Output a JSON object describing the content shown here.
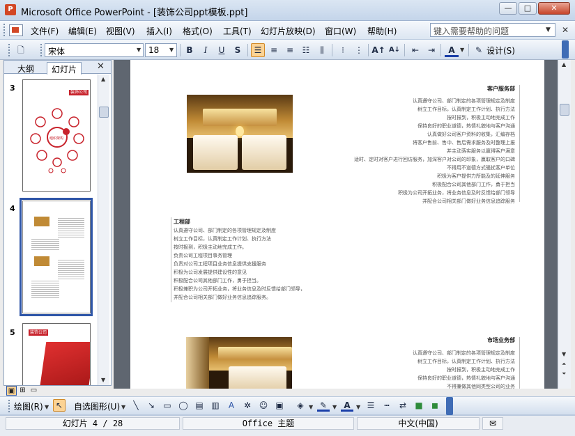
{
  "window": {
    "title": "Microsoft Office PowerPoint - [装饰公司ppt模板.ppt]",
    "min_label": "—",
    "max_label": "□",
    "close_label": "✕"
  },
  "menu": {
    "items": [
      "文件(F)",
      "编辑(E)",
      "视图(V)",
      "插入(I)",
      "格式(O)",
      "工具(T)",
      "幻灯片放映(D)",
      "窗口(W)",
      "帮助(H)"
    ],
    "help_placeholder": "键入需要帮助的问题",
    "doc_close": "✕"
  },
  "format_toolbar": {
    "font_name": "宋体",
    "font_size": "18",
    "bold": "B",
    "italic": "I",
    "underline": "U",
    "shadow": "S",
    "design_label": "设计(S)"
  },
  "left_pane": {
    "tab_outline": "大纲",
    "tab_slides": "幻灯片",
    "close": "✕",
    "slides": [
      {
        "number": "3",
        "logo_text": "装饰公司",
        "center_text": "组织架构"
      },
      {
        "number": "4"
      },
      {
        "number": "5",
        "logo_text": "装饰公司"
      }
    ]
  },
  "slide": {
    "section1": {
      "title": "客户服务部",
      "lines": [
        "认真遵守公司、部门制定的各项管理规定及制度",
        "树立工作目标，认真制定工作计划、执行方法",
        "按时报到，积极主动地完成工作",
        "保持良好的职业道德，热情礼貌地与客户沟通",
        "认真做好公司客户资料的收集，汇编存档",
        "将客户售前、售中、售后需求服务及时整理上报",
        "并主动落实服务以赢得客户满意",
        "适时、定时对客户进行回访服务，加深客户对公司的印象，赢取客户的口碑",
        "不得用不道德方式骚扰客户单位",
        "积极为客户提供力所能及的延伸服务",
        "积极配合公司其他部门工作，勇于担当",
        "积极为公司开拓业务，将业务信息及时反馈给部门领导",
        "并配合公司相关部门做好业务信息追踪服务"
      ]
    },
    "section2": {
      "title": "工程部",
      "lines": [
        "认真遵守公司、部门制定的各项管理规定及制度",
        "树立工作目标，认真制定工作计划、执行方法",
        "按时报到，积极主动地完成工作。",
        "负责公司工程项目事务管理",
        "负责对公司工程项目业务信息提供支援服务",
        "积极为公司发展提供建设性的意见",
        "积极配合公司其他部门工作，勇于担当。",
        "积极兼职为公司开拓业务，将业务信息及时反馈给部门领导，",
        "并配合公司相关部门做好业务信息追踪服务。"
      ]
    },
    "section3": {
      "title": "市场业务部",
      "lines": [
        "认真遵守公司、部门制定的各项管理规定及制度",
        "树立工作目标，认真制定工作计划、执行方法",
        "按时报到，积极主动地完成工作",
        "保持良好的职业道德，热情礼貌地与客户沟通",
        "不得兼做其他同类型公司的业务"
      ]
    }
  },
  "draw_toolbar": {
    "draw_label": "绘图(R)",
    "autoshapes_label": "自选图形(U)"
  },
  "status": {
    "slide_info": "幻灯片 4 / 28",
    "theme": "Office 主题",
    "language": "中文(中国)"
  }
}
